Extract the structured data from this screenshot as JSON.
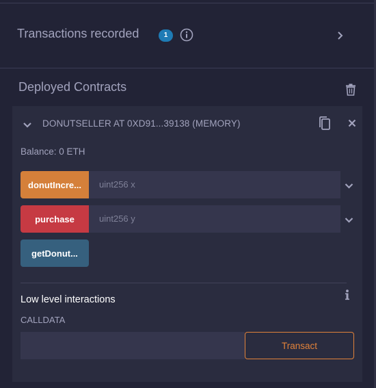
{
  "transactions": {
    "title": "Transactions recorded",
    "count": "1"
  },
  "deployed": {
    "title": "Deployed Contracts"
  },
  "contract": {
    "name": "DONUTSELLER AT 0XD91...39138 (MEMORY)",
    "balance": "Balance: 0 ETH",
    "functions": [
      {
        "label": "donutIncre...",
        "placeholder": "uint256 x",
        "color": "#d5803a"
      },
      {
        "label": "purchase",
        "placeholder": "uint256 y",
        "color": "#c63a43"
      },
      {
        "label": "getDonut...",
        "color": "#36607e"
      }
    ]
  },
  "low_level": {
    "title": "Low level interactions",
    "calldata_label": "CALLDATA",
    "transact_label": "Transact"
  },
  "colors": {
    "background": "#222336",
    "card": "#2a2c3f",
    "accent_orange": "#e1823a",
    "badge": "#1e7bb5"
  },
  "icons": [
    "info-icon",
    "chevron-right-icon",
    "trash-icon",
    "chevron-down-icon",
    "copy-icon",
    "close-icon"
  ]
}
